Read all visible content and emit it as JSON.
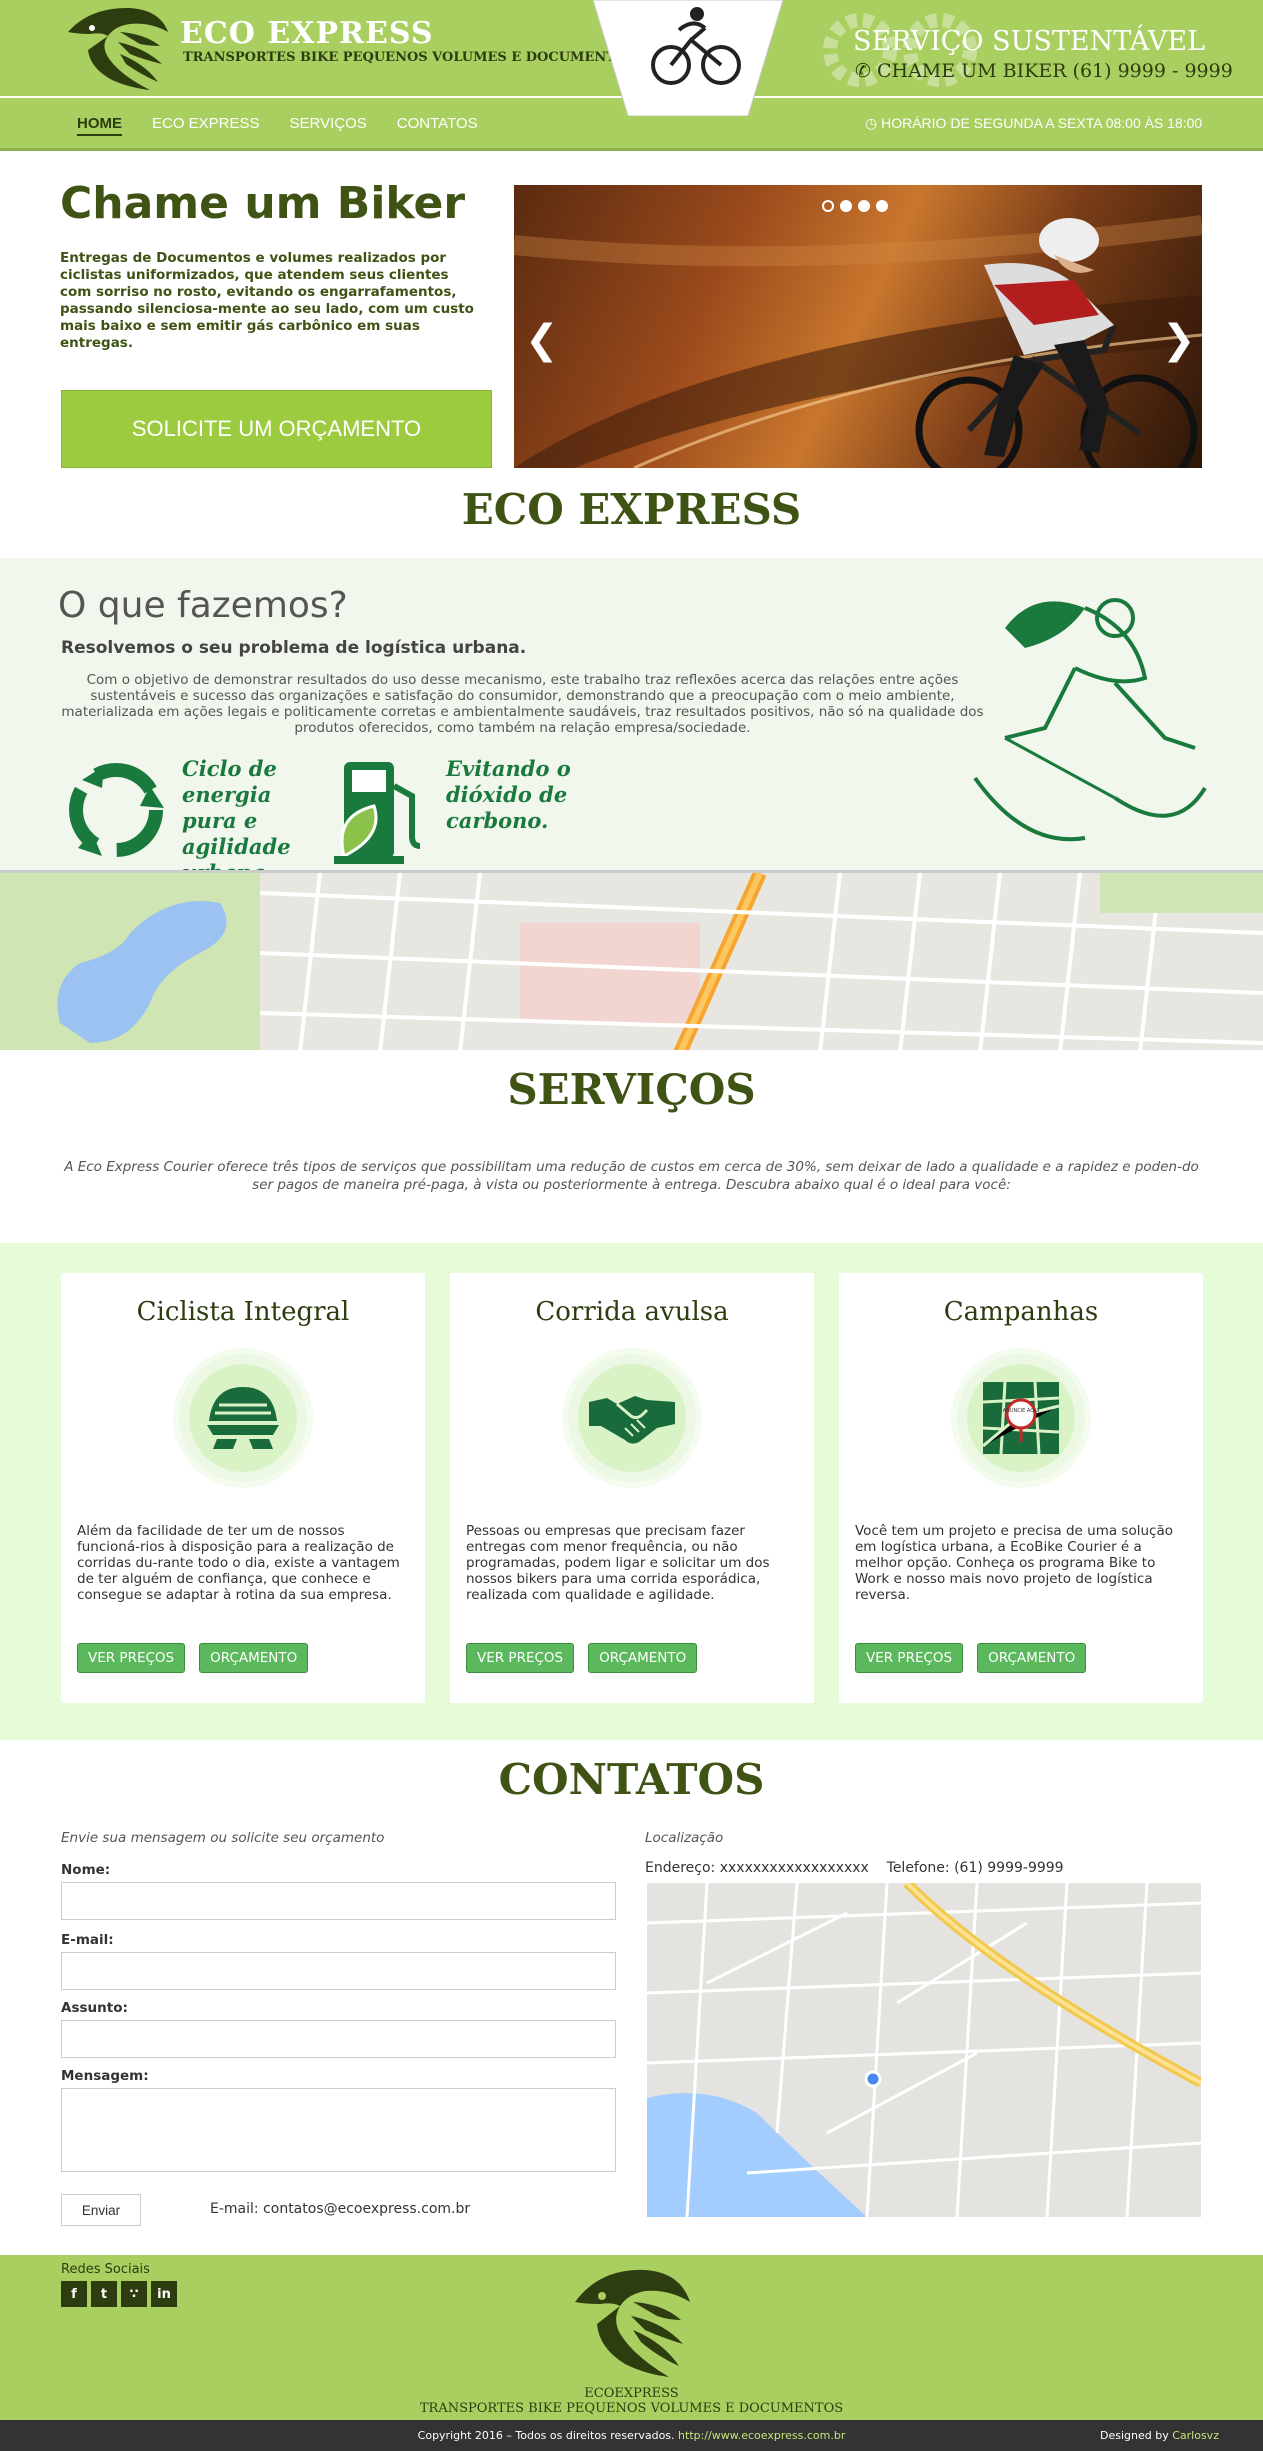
{
  "header": {
    "brand": "ECO EXPRESS",
    "tagline": "TRANSPORTES BIKE PEQUENOS VOLUMES E DOCUMENTOS",
    "service_title": "SERVIÇO SUSTENTÁVEL",
    "phone": "CHAME UM BIKER (61) 9999 - 9999",
    "hours": "HORÁRIO DE SEGUNDA A SEXTA 08:00 ÀS 18:00",
    "accent_color": "#a9cf61",
    "dark_color": "#2e3d10"
  },
  "nav": {
    "items": [
      {
        "label": "HOME",
        "active": true
      },
      {
        "label": "ECO EXPRESS",
        "active": false
      },
      {
        "label": "SERVIÇOS",
        "active": false
      },
      {
        "label": "CONTATOS",
        "active": false
      }
    ]
  },
  "hero": {
    "title": "Chame um Biker",
    "text": "Entregas de Documentos e volumes realizados por ciclistas uniformizados, que atendem seus clientes com sorriso no rosto, evitando os engarrafamentos, passando silenciosa-mente ao seu lado, com um custo mais baixo e sem emitir gás carbônico em suas entregas.",
    "cta": "SOLICITE UM ORÇAMENTO",
    "slider_prev": "❮",
    "slider_next": "❯"
  },
  "eco_section": {
    "heading": "ECO EXPRESS"
  },
  "whatwedo": {
    "title": "O que fazemos?",
    "subtitle": "Resolvemos o seu problema de logística urbana.",
    "text": "Com o objetivo de demonstrar resultados do uso desse mecanismo, este trabalho traz reflexões acerca das relações entre ações sustentáveis e sucesso das organizações e  satisfação do consumidor, demonstrando que a preocupação com o meio ambiente, materializada em ações legais e  politicamente corretas e ambientalmente saudáveis, traz resultados positivos, não só na qualidade dos produtos  oferecidos, como também na relação empresa/sociedade.",
    "feature1": "Ciclo de energia pura e agilidade urbana.",
    "feature2": "Evitando o dióxido de carbono."
  },
  "services": {
    "heading": "SERVIÇOS",
    "intro": "A Eco Express Courier oferece três tipos de serviços que possibilitam uma redução de custos em cerca de 30%, sem deixar de lado a qualidade e a rapidez e poden-do ser pagos de maneira pré-paga, à vista ou posteriormente à entrega. Descubra abaixo qual é o ideal para você:",
    "cards": [
      {
        "title": "Ciclista Integral",
        "icon": "helmet-icon",
        "text": "Além da facilidade de ter um de nossos funcioná-rios à disposição para a realização de corridas du-rante todo o dia, existe a vantagem de ter alguém de confiança, que conhece e consegue se adaptar à rotina da sua empresa.",
        "btn1": "VER PREÇOS",
        "btn2": "ORÇAMENTO"
      },
      {
        "title": "Corrida avulsa",
        "icon": "handshake-icon",
        "text": "Pessoas ou empresas que precisam fazer entregas com menor frequência, ou não programadas, podem ligar e solicitar um dos nossos bikers para uma corrida esporádica, realizada com qualidade e agilidade.",
        "btn1": "VER PREÇOS",
        "btn2": "ORÇAMENTO"
      },
      {
        "title": "Campanhas",
        "icon": "city-map-icon",
        "text": "Você tem um projeto e precisa de uma solução em logística urbana, a EcoBike Courier é a melhor opção. Conheça os programa Bike to Work e nosso mais novo projeto de logística reversa.",
        "btn1": "VER PREÇOS",
        "btn2": "ORÇAMENTO",
        "badge": "ANUNCIE AQUI"
      }
    ]
  },
  "contact": {
    "heading": "CONTATOS",
    "form_title": "Envie sua mensagem ou solicite seu orçamento",
    "name_label": "Nome:",
    "email_label": "E-mail:",
    "subject_label": "Assunto:",
    "message_label": "Mensagem:",
    "send": "Enviar",
    "email": "E-mail: contatos@ecoexpress.com.br",
    "location_title": "Localização",
    "address": "Endereço: xxxxxxxxxxxxxxxxxx    Telefone: (61) 9999-9999"
  },
  "footer": {
    "social_title": "Redes Sociais",
    "social": [
      "f",
      "t",
      "rss",
      "in"
    ],
    "brand": "ECOEXPRESS",
    "tagline": "TRANSPORTES BIKE PEQUENOS VOLUMES E DOCUMENTOS",
    "copyright": "Copyright 2016 – Todos os direitos reservados.",
    "url": "http://www.ecoexpress.com.br",
    "designed_by": "Designed by",
    "designer": "Carlosvz"
  }
}
